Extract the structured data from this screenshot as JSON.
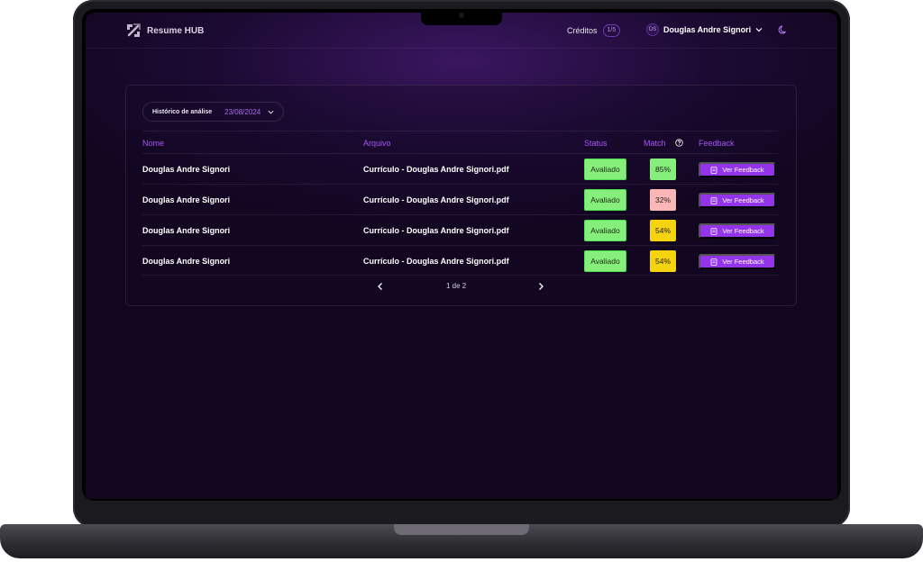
{
  "app": {
    "name": "Resume HUB"
  },
  "header": {
    "credits_label": "Créditos",
    "credits_value": "1/5",
    "user_initials": "DS",
    "user_name": "Douglas Andre Signori"
  },
  "history": {
    "label": "Histórico de análise",
    "date": "23/08/2024"
  },
  "table": {
    "columns": [
      "Nome",
      "Arquivo",
      "Status",
      "Match",
      "Feedback"
    ],
    "rows": [
      {
        "name": "Douglas Andre Signori",
        "file": "Currículo - Douglas Andre Signori.pdf",
        "status": "Avaliado",
        "match": "85%",
        "match_color": "#86ef7c",
        "feedback": "Ver Feedback"
      },
      {
        "name": "Douglas Andre Signori",
        "file": "Currículo - Douglas Andre Signori.pdf",
        "status": "Avaliado",
        "match": "32%",
        "match_color": "#fbb6b6",
        "feedback": "Ver Feedback"
      },
      {
        "name": "Douglas Andre Signori",
        "file": "Currículo - Douglas Andre Signori.pdf",
        "status": "Avaliado",
        "match": "54%",
        "match_color": "#f5d40f",
        "feedback": "Ver Feedback"
      },
      {
        "name": "Douglas Andre Signori",
        "file": "Currículo - Douglas Andre Signori.pdf",
        "status": "Avaliado",
        "match": "54%",
        "match_color": "#f5d40f",
        "feedback": "Ver Feedback"
      }
    ]
  },
  "pagination": {
    "label": "1 de 2"
  },
  "colors": {
    "accent": "#9333ea",
    "status_green": "#86ef7c"
  }
}
